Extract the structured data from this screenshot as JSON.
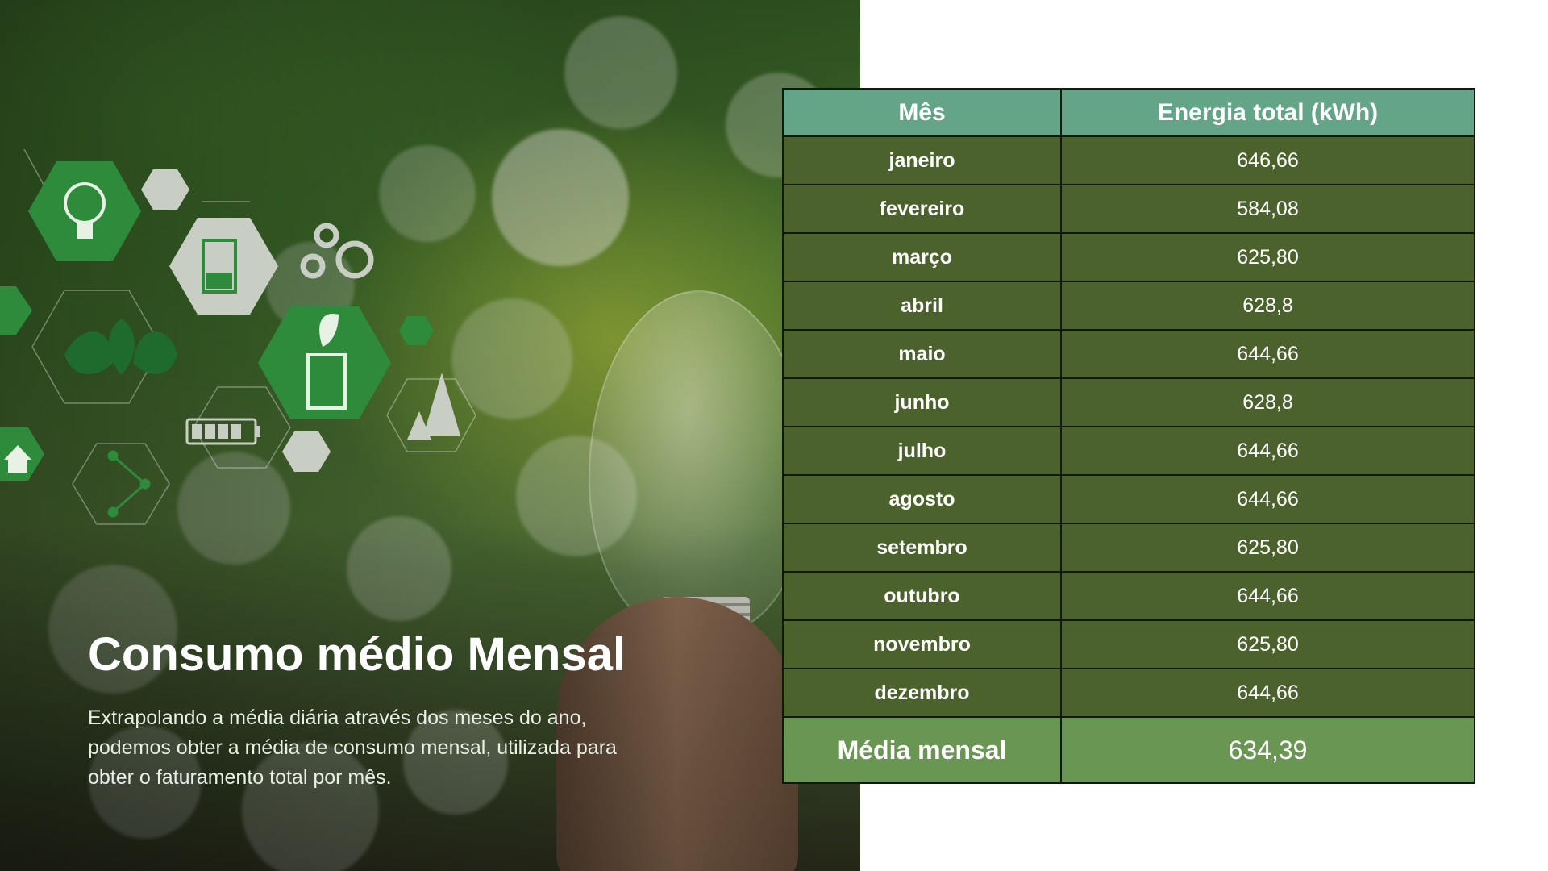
{
  "slide": {
    "title": "Consumo médio Mensal",
    "description": "Extrapolando a média diária através dos meses do ano, podemos obter a média de consumo mensal, utilizada para obter o faturamento total por mês."
  },
  "table": {
    "headers": [
      "Mês",
      "Energia total (kWh)"
    ],
    "rows": [
      {
        "month": "janeiro",
        "value": "646,66"
      },
      {
        "month": "fevereiro",
        "value": "584,08"
      },
      {
        "month": "março",
        "value": "625,80"
      },
      {
        "month": "abril",
        "value": "628,8"
      },
      {
        "month": "maio",
        "value": "644,66"
      },
      {
        "month": "junho",
        "value": "628,8"
      },
      {
        "month": "julho",
        "value": "644,66"
      },
      {
        "month": "agosto",
        "value": "644,66"
      },
      {
        "month": "setembro",
        "value": "625,80"
      },
      {
        "month": "outubro",
        "value": "644,66"
      },
      {
        "month": "novembro",
        "value": "625,80"
      },
      {
        "month": "dezembro",
        "value": "644,66"
      }
    ],
    "summary": {
      "label": "Média mensal",
      "value": "634,39"
    }
  },
  "colors": {
    "header_bg": "#63a586",
    "row_bg": "#4b622c",
    "summary_bg": "#6a9653",
    "icon_green": "#2e8b3c"
  },
  "icons": [
    "lightbulb-icon",
    "beaker-icon",
    "gears-icon",
    "leaf-icon",
    "plant-beaker-icon",
    "battery-icon",
    "trees-icon",
    "molecule-icon",
    "house-icon"
  ]
}
